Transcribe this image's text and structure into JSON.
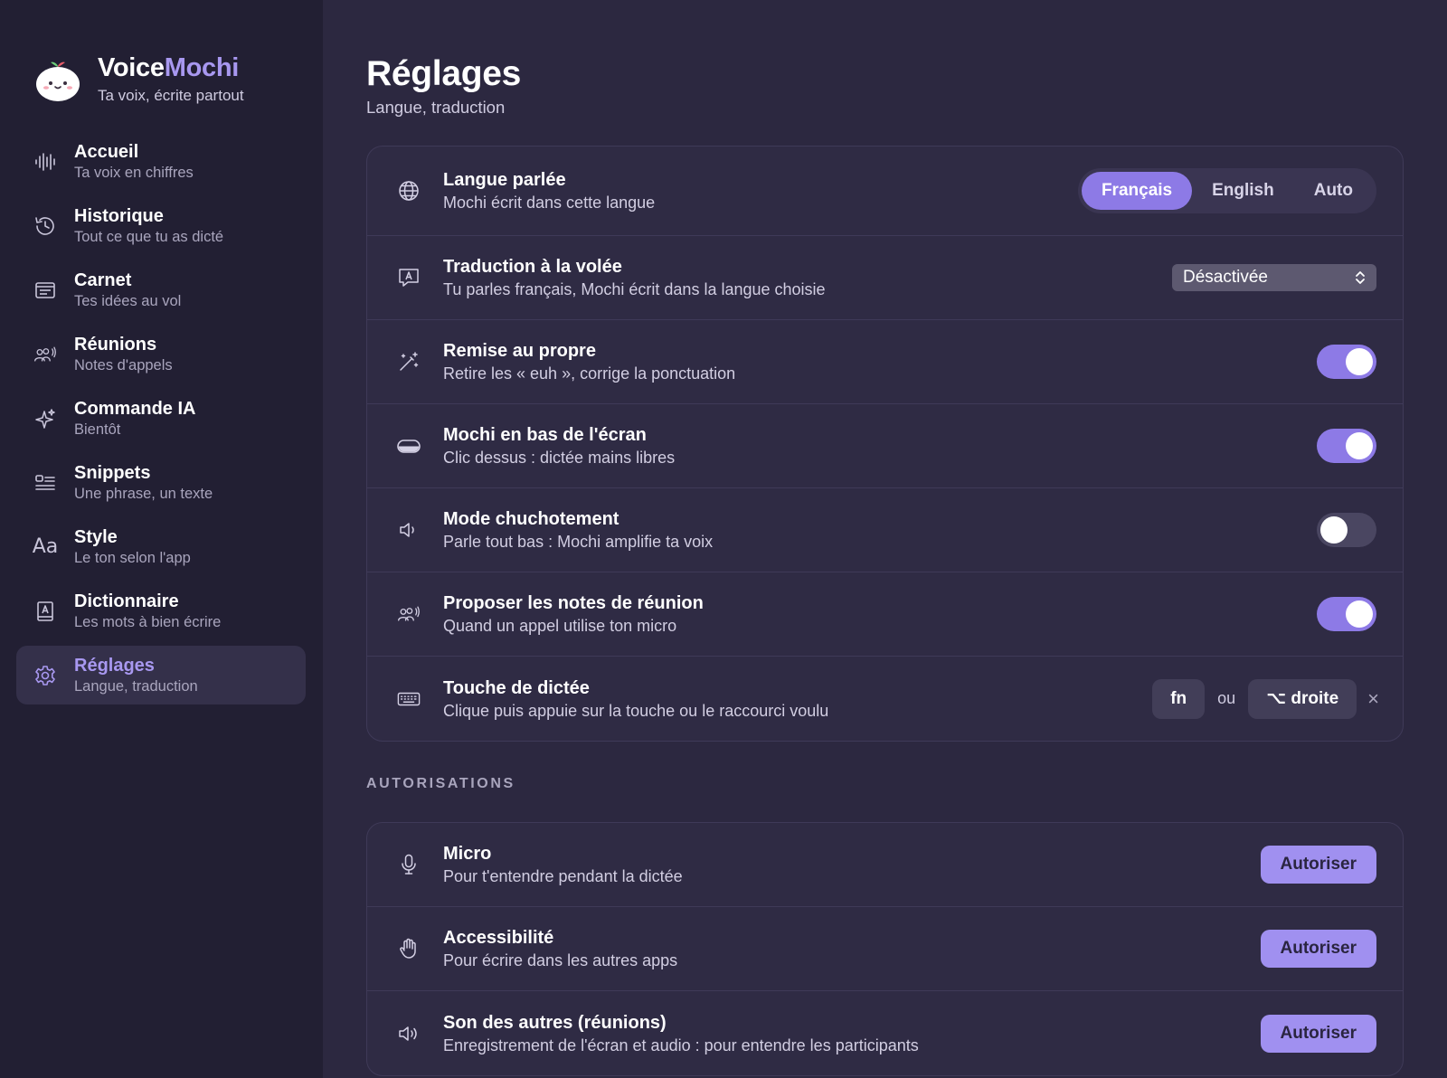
{
  "app": {
    "name_part1": "Voice",
    "name_part2": "Mochi",
    "tagline": "Ta voix, écrite partout",
    "accent_color": "#a898f0"
  },
  "sidebar": {
    "items": [
      {
        "title": "Accueil",
        "subtitle": "Ta voix en chiffres",
        "icon": "waveform-icon"
      },
      {
        "title": "Historique",
        "subtitle": "Tout ce que tu as dicté",
        "icon": "history-icon"
      },
      {
        "title": "Carnet",
        "subtitle": "Tes idées au vol",
        "icon": "notebook-icon"
      },
      {
        "title": "Réunions",
        "subtitle": "Notes d'appels",
        "icon": "people-icon"
      },
      {
        "title": "Commande IA",
        "subtitle": "Bientôt",
        "icon": "sparkle-icon"
      },
      {
        "title": "Snippets",
        "subtitle": "Une phrase, un texte",
        "icon": "snippets-icon"
      },
      {
        "title": "Style",
        "subtitle": "Le ton selon l'app",
        "icon": "text-style-icon",
        "glyph": "Aa"
      },
      {
        "title": "Dictionnaire",
        "subtitle": "Les mots à bien écrire",
        "icon": "dictionary-icon"
      },
      {
        "title": "Réglages",
        "subtitle": "Langue, traduction",
        "icon": "gear-icon",
        "active": true
      }
    ]
  },
  "page": {
    "title": "Réglages",
    "subtitle": "Langue, traduction"
  },
  "settings": {
    "language": {
      "title": "Langue parlée",
      "subtitle": "Mochi écrit dans cette langue",
      "options": [
        "Français",
        "English",
        "Auto"
      ],
      "selected": "Français"
    },
    "translation": {
      "title": "Traduction à la volée",
      "subtitle": "Tu parles français, Mochi écrit dans la langue choisie",
      "value": "Désactivée"
    },
    "cleanup": {
      "title": "Remise au propre",
      "subtitle": "Retire les « euh », corrige la ponctuation",
      "enabled": true
    },
    "bottom_mochi": {
      "title": "Mochi en bas de l'écran",
      "subtitle": "Clic dessus : dictée mains libres",
      "enabled": true
    },
    "whisper": {
      "title": "Mode chuchotement",
      "subtitle": "Parle tout bas : Mochi amplifie ta voix",
      "enabled": false
    },
    "meeting_notes": {
      "title": "Proposer les notes de réunion",
      "subtitle": "Quand un appel utilise ton micro",
      "enabled": true
    },
    "dictation_key": {
      "title": "Touche de dictée",
      "subtitle": "Clique puis appuie sur la touche ou le raccourci voulu",
      "key1": "fn",
      "separator": "ou",
      "key2": "⌥ droite",
      "clear": "×"
    }
  },
  "permissions": {
    "section_label": "AUTORISATIONS",
    "button_label": "Autoriser",
    "items": [
      {
        "title": "Micro",
        "subtitle": "Pour t'entendre pendant la dictée",
        "icon": "microphone-icon"
      },
      {
        "title": "Accessibilité",
        "subtitle": "Pour écrire dans les autres apps",
        "icon": "hand-icon"
      },
      {
        "title": "Son des autres (réunions)",
        "subtitle": "Enregistrement de l'écran et audio : pour entendre les participants",
        "icon": "speaker-icon"
      }
    ]
  }
}
